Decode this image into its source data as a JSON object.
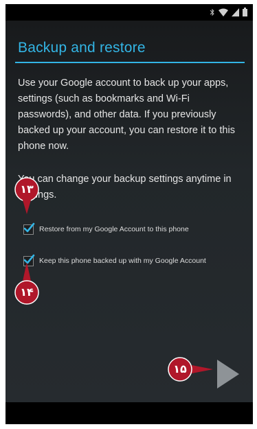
{
  "screen": {
    "title": "Backup and restore",
    "description": "Use your Google account to back up your apps, settings (such as bookmarks and Wi-Fi passwords), and other data. If you previously backed up your account, you can restore it to this phone now.",
    "settings_note": "You can change your backup settings anytime in Settings."
  },
  "options": [
    {
      "label": "Restore from my Google Account to this phone",
      "checked": true
    },
    {
      "label": "Keep this phone backed up with my Google Account",
      "checked": true
    }
  ],
  "callouts": {
    "restore": "۱۳",
    "backup": "۱۴",
    "next": "۱۵"
  },
  "status_icons": [
    "bluetooth-icon",
    "wifi-icon",
    "signal-icon",
    "battery-icon"
  ],
  "colors": {
    "accent": "#33b5e5",
    "callout": "#b0172a",
    "background": "#22272a"
  }
}
